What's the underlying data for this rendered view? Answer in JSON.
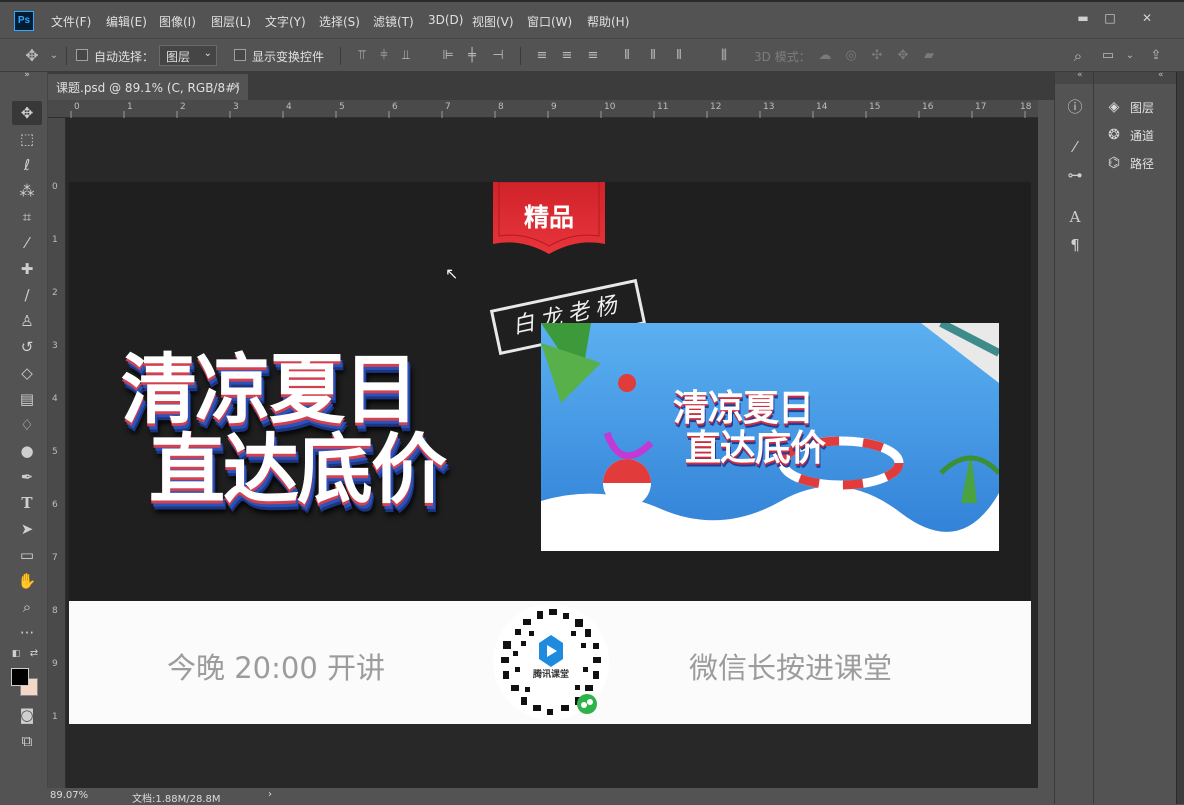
{
  "app": {
    "logo": "Ps"
  },
  "menu": {
    "items": [
      "文件(F)",
      "编辑(E)",
      "图像(I)",
      "图层(L)",
      "文字(Y)",
      "选择(S)",
      "滤镜(T)",
      "3D(D)",
      "视图(V)",
      "窗口(W)",
      "帮助(H)"
    ]
  },
  "window_controls": {
    "minimize": "▬",
    "maximize": "□",
    "close": "✕"
  },
  "options": {
    "auto_select_label": "自动选择：",
    "auto_select_target": "图层",
    "show_transform_label": "显示变换控件",
    "mode_3d_label": "3D 模式："
  },
  "document": {
    "tab_title": "课题.psd @ 89.1% (C, RGB/8#)",
    "close_glyph": "×"
  },
  "ruler": {
    "top_ticks": [
      "0",
      "1",
      "2",
      "3",
      "4",
      "5",
      "6",
      "7",
      "8",
      "9",
      "10",
      "11",
      "12",
      "13",
      "14",
      "15",
      "16",
      "17",
      "18"
    ],
    "left_ticks": [
      "0",
      "1",
      "2",
      "3",
      "4",
      "5",
      "6",
      "7",
      "8",
      "9",
      "1"
    ]
  },
  "canvas": {
    "ribbon_label": "精品",
    "stamp_text": "白龙老杨",
    "hero_line_1": "清凉夏日",
    "hero_line_2": "直达底价",
    "preview_line_1": "清凉夏日",
    "preview_line_2": "直达底价",
    "time_text": "今晚 20:00 开讲",
    "qr_label": "腾讯课堂",
    "wechat_text": "微信长按进课堂"
  },
  "status": {
    "zoom": "89.07%",
    "doc_info": "文档:1.88M/28.8M",
    "arrow": "›"
  },
  "panels": [
    {
      "label": "图层",
      "icon": "layers-icon"
    },
    {
      "label": "通道",
      "icon": "channels-icon"
    },
    {
      "label": "路径",
      "icon": "paths-icon"
    }
  ],
  "colors": {
    "foreground": "#000000",
    "background": "#f5d7c8",
    "accent": "#31a8ff"
  }
}
